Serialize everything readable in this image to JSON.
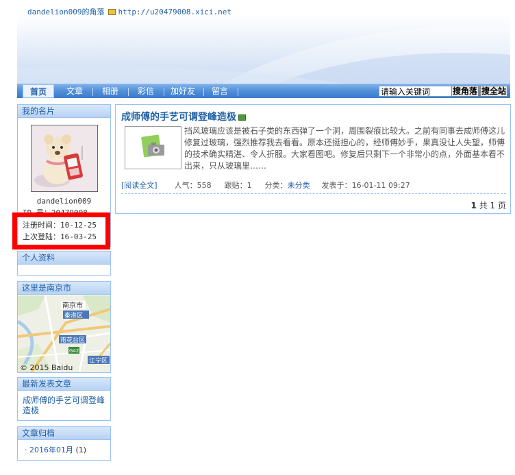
{
  "header": {
    "site_title": "dandelion009的角落",
    "site_url": "http://u20479008.xici.net"
  },
  "nav": {
    "items": [
      "首页",
      "文章",
      "相册",
      "彩信",
      "加好友",
      "留言"
    ],
    "search_placeholder": "请输入关键词",
    "search_site_button": "搜角落",
    "search_all_button": "搜全站"
  },
  "profile": {
    "box_title": "我的名片",
    "username": "dandelion009",
    "id_line": "ID    号：20479008",
    "register": "注册时间：10-12-25",
    "last_login": "上次登陆：16-03-25"
  },
  "personal": {
    "box_title": "个人资料"
  },
  "map": {
    "box_title": "这里是南京市",
    "labels": {
      "city": "南京市",
      "qinhuai": "秦淮区",
      "yuhuatai": "雨花台区",
      "jiangning": "江宁区",
      "road": "G42",
      "copyright": "© 2015 Baidu"
    }
  },
  "recent": {
    "box_title": "最新发表文章",
    "items": [
      "成师傅的手艺可谓登峰造极"
    ]
  },
  "archive": {
    "box_title": "文章归档",
    "items": [
      {
        "label": "2016年01月",
        "count": "(1)"
      }
    ]
  },
  "post": {
    "title": "成师傅的手艺可谓登峰造极",
    "excerpt": "挡风玻璃应该是被石子类的东西弹了一个洞，周围裂痕比较大。之前有同事去成师傅这儿修复过玻璃，强烈推荐我去看看。原本还挺担心的，经师傅妙手，果真没让人失望，师傅的技术确实精湛、令人折服。大家看图吧。修复后只剩下一个非常小的点，外面基本看不出来，只从玻璃里……",
    "read_more": "[阅读全文]",
    "views_label": "人气：",
    "views": "558",
    "replies_label": "跟贴：",
    "replies": "1",
    "category_label": "分类：",
    "category": "未分类",
    "posted_label": "发表于：",
    "posted": "16-01-11 09:27"
  },
  "pager": {
    "current": "1",
    "text": "共 1 页"
  },
  "colors": {
    "accent": "#1f5fa5",
    "nav": "#4f8fd9",
    "border": "#9cc3ef",
    "highlight": "#ff0000"
  }
}
